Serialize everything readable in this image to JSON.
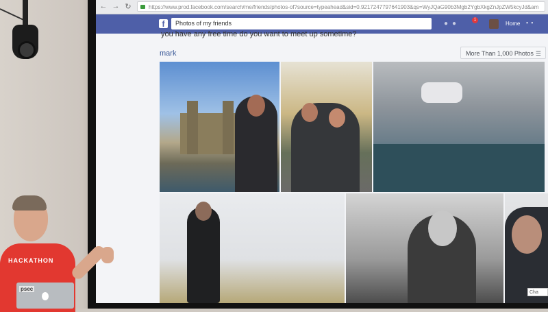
{
  "browser": {
    "back_icon": "←",
    "forward_icon": "→",
    "reload_icon": "↻",
    "url": "https://www.prod.facebook.com/search/me/friends/photos-of?source=typeahead&sid=0.9217247797641903&qs=WyJQaG90b3Mgb2YgbXkgZnJpZW5kcyJd&am"
  },
  "facebook": {
    "logo": "f",
    "search_query": "Photos of my friends",
    "notification_count": "1",
    "home_label": "Home"
  },
  "content": {
    "message_text": "you have any free time do you want to meet up sometime?",
    "author": "mark",
    "more_button": "More Than 1,000 Photos",
    "chat_label": "Cha"
  },
  "presenter": {
    "shirt_text": "HACKATHON",
    "laptop_sticker": "psec"
  }
}
